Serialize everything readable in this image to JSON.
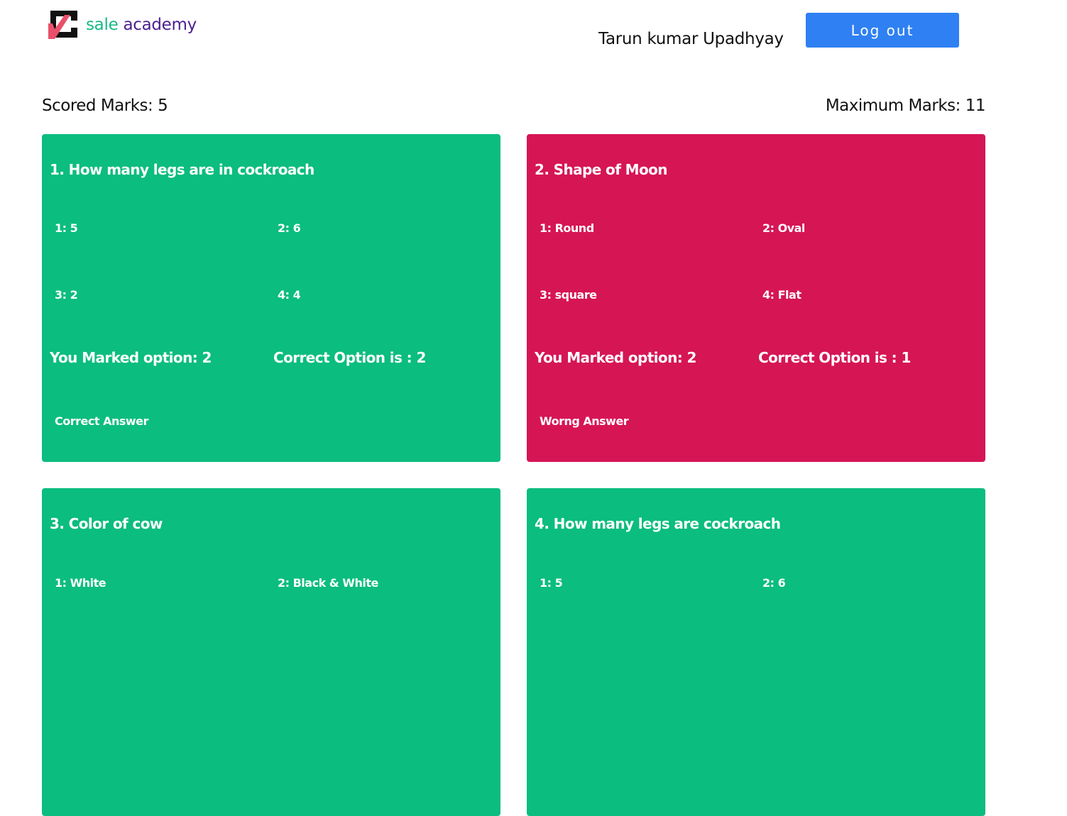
{
  "brand": {
    "word1": "sale",
    "word2": "academy",
    "green": "#16b886",
    "purple": "#4b1f8f"
  },
  "header": {
    "user_name": "Tarun kumar Upadhyay",
    "logout_label": "Log out"
  },
  "summary": {
    "scored": "Scored Marks: 5",
    "maximum": "Maximum Marks: 11"
  },
  "colors": {
    "correct": "#0bbd7f",
    "wrong": "#d61555",
    "button": "#2f80f2"
  },
  "questions": [
    {
      "title": "1. How many legs are in cockroach",
      "options": [
        "1: 5",
        "2: 6",
        "3: 2",
        "4: 4"
      ],
      "marked": "You Marked option: 2",
      "correct": "Correct Option is : 2",
      "status": "Correct Answer"
    },
    {
      "title": "2. Shape of Moon",
      "options": [
        "1: Round",
        "2: Oval",
        "3: square",
        "4: Flat"
      ],
      "marked": "You Marked option: 2",
      "correct": "Correct Option is : 1",
      "status": "Worng Answer"
    },
    {
      "title": "3. Color of cow",
      "options": [
        "1: White",
        "2: Black & White"
      ]
    },
    {
      "title": "4. How many legs are cockroach",
      "options": [
        "1: 5",
        "2: 6"
      ]
    }
  ]
}
